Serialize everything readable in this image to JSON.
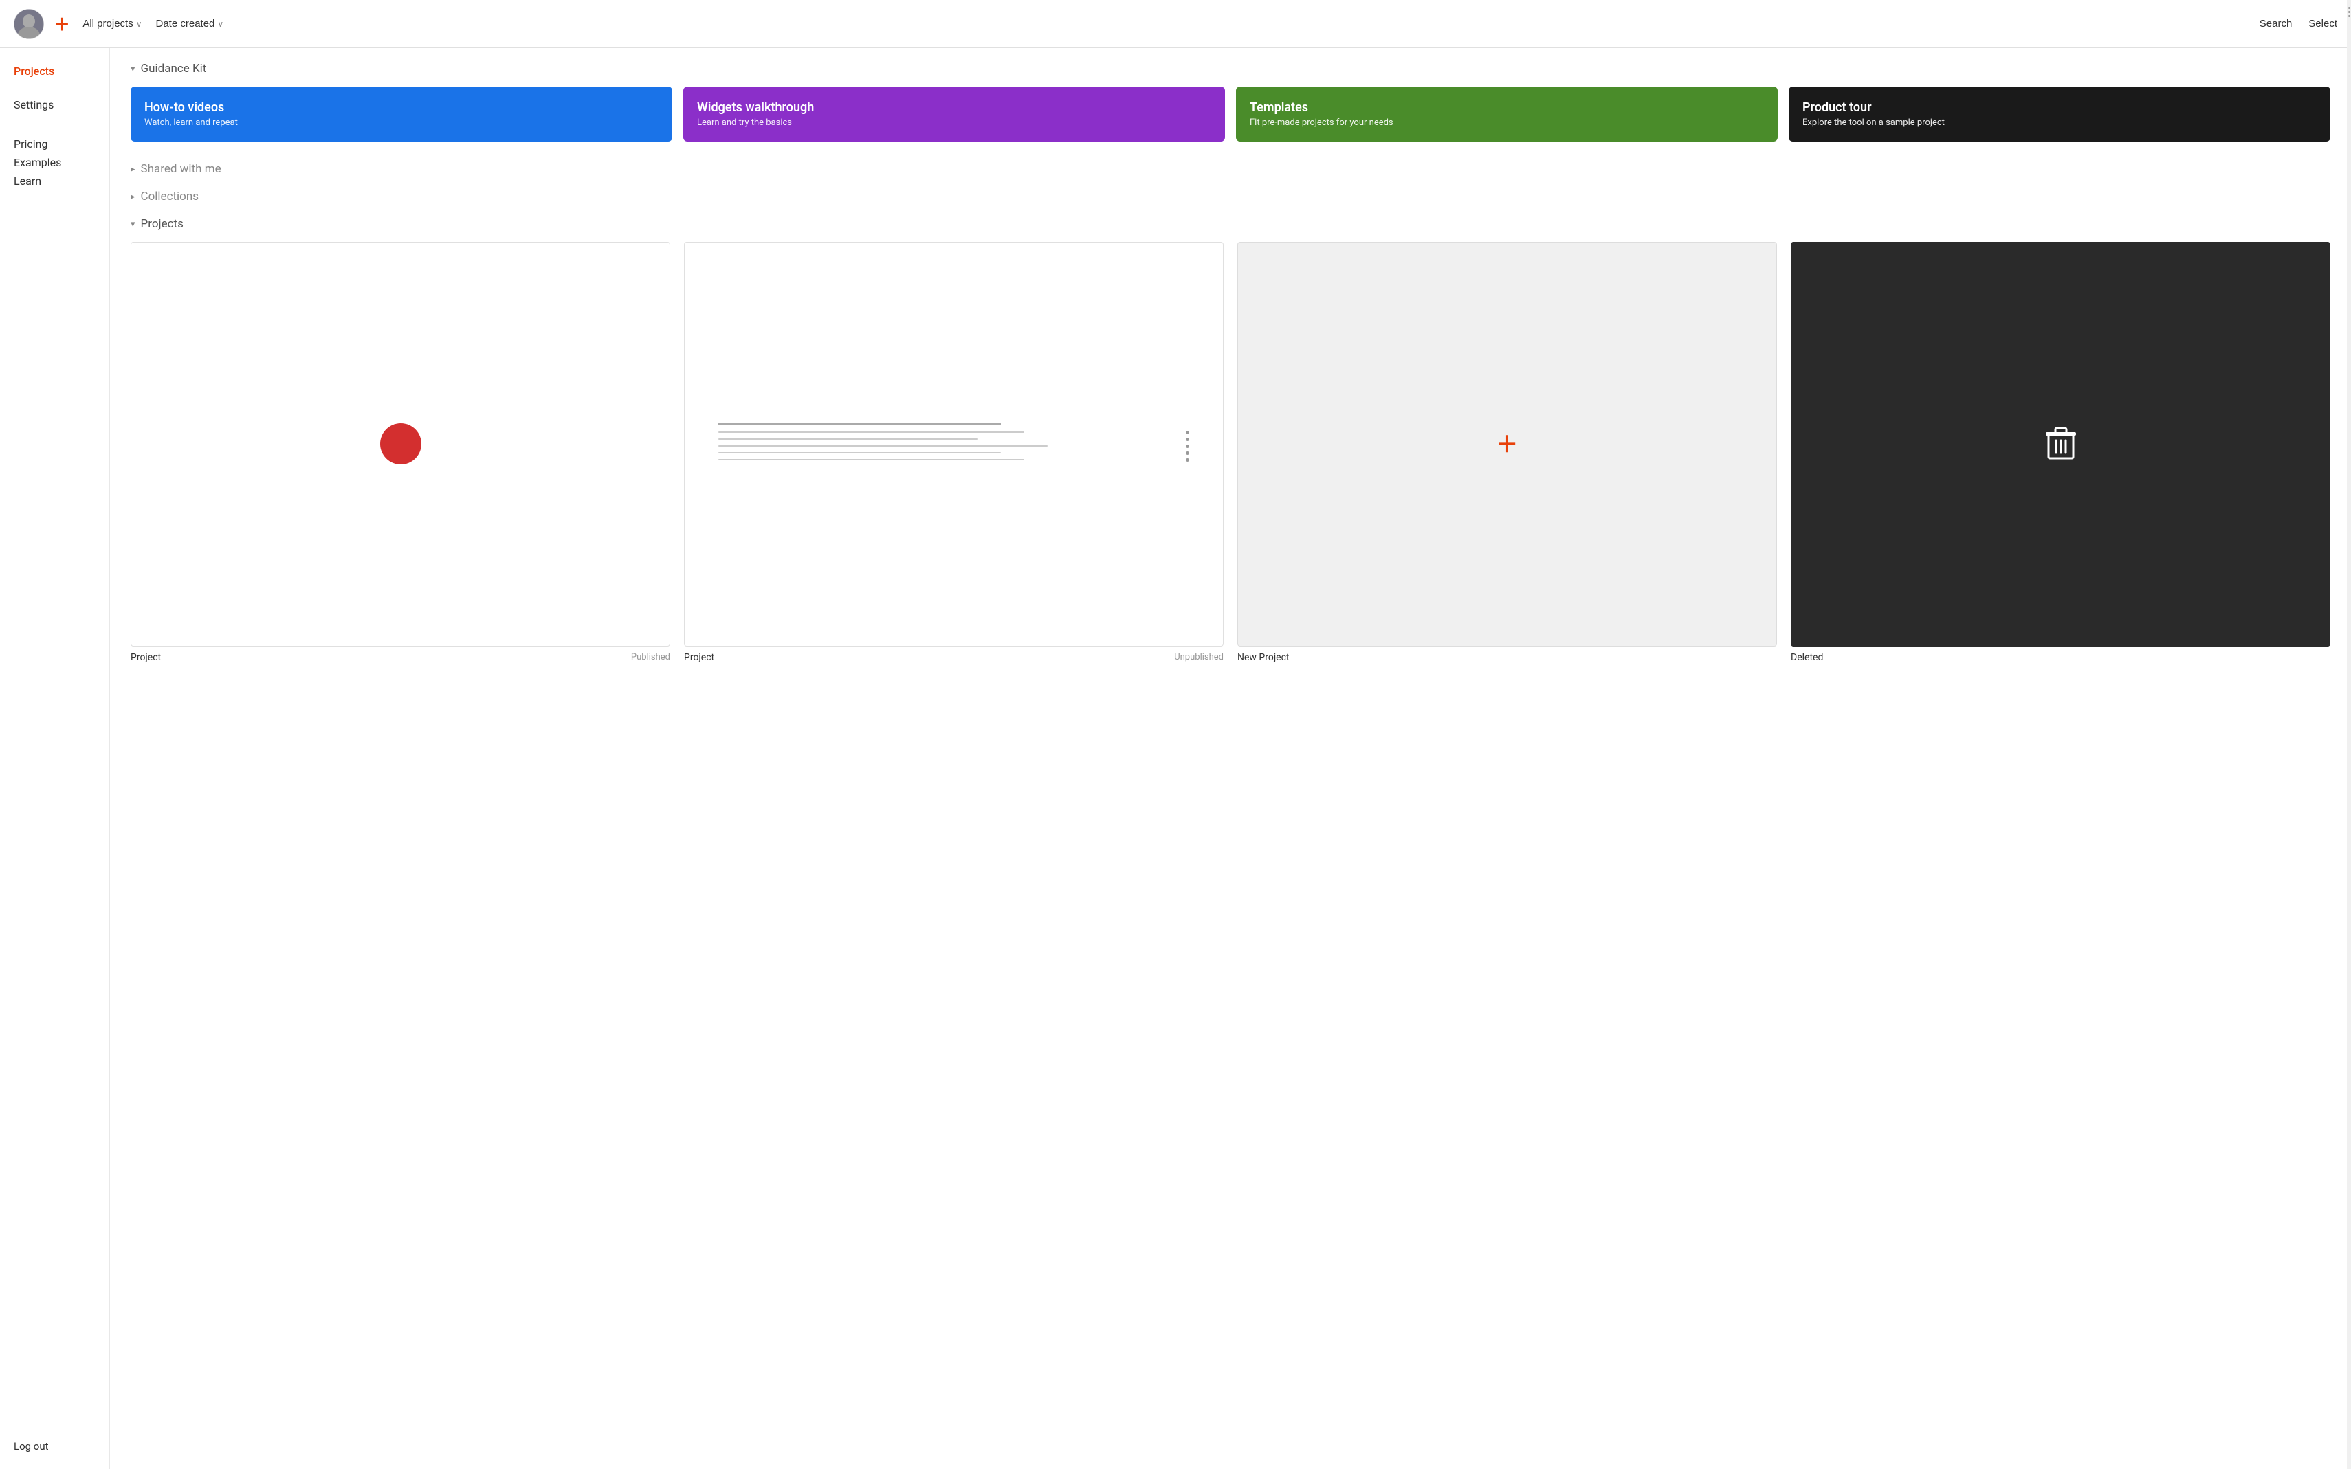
{
  "header": {
    "filter_all_projects": "All projects",
    "filter_date_created": "Date created",
    "search_label": "Search",
    "select_label": "Select"
  },
  "sidebar": {
    "nav_items": [
      {
        "id": "projects",
        "label": "Projects",
        "active": true
      },
      {
        "id": "settings",
        "label": "Settings",
        "active": false
      }
    ],
    "secondary_items": [
      {
        "id": "pricing",
        "label": "Pricing"
      },
      {
        "id": "examples",
        "label": "Examples"
      },
      {
        "id": "learn",
        "label": "Learn"
      }
    ],
    "footer_items": [
      {
        "id": "logout",
        "label": "Log out"
      }
    ]
  },
  "guidance_kit": {
    "section_title": "Guidance Kit",
    "cards": [
      {
        "id": "how-to-videos",
        "title": "How-to videos",
        "subtitle": "Watch, learn and repeat",
        "color_class": "card-blue"
      },
      {
        "id": "widgets-walkthrough",
        "title": "Widgets walkthrough",
        "subtitle": "Learn and try the basics",
        "color_class": "card-purple"
      },
      {
        "id": "templates",
        "title": "Templates",
        "subtitle": "Fit pre-made projects for your needs",
        "color_class": "card-green"
      },
      {
        "id": "product-tour",
        "title": "Product tour",
        "subtitle": "Explore the tool on a sample project",
        "color_class": "card-dark"
      }
    ]
  },
  "shared_with_me": {
    "section_title": "Shared with me",
    "collapsed": true
  },
  "collections": {
    "section_title": "Collections",
    "collapsed": true
  },
  "projects": {
    "section_title": "Projects",
    "items": [
      {
        "id": "project-1",
        "name": "Project",
        "status": "Published",
        "type": "circle"
      },
      {
        "id": "project-2",
        "name": "Project",
        "status": "Unpublished",
        "type": "doclist"
      },
      {
        "id": "new-project",
        "name": "New Project",
        "status": "",
        "type": "new"
      },
      {
        "id": "deleted",
        "name": "Deleted",
        "status": "",
        "type": "deleted"
      }
    ]
  }
}
